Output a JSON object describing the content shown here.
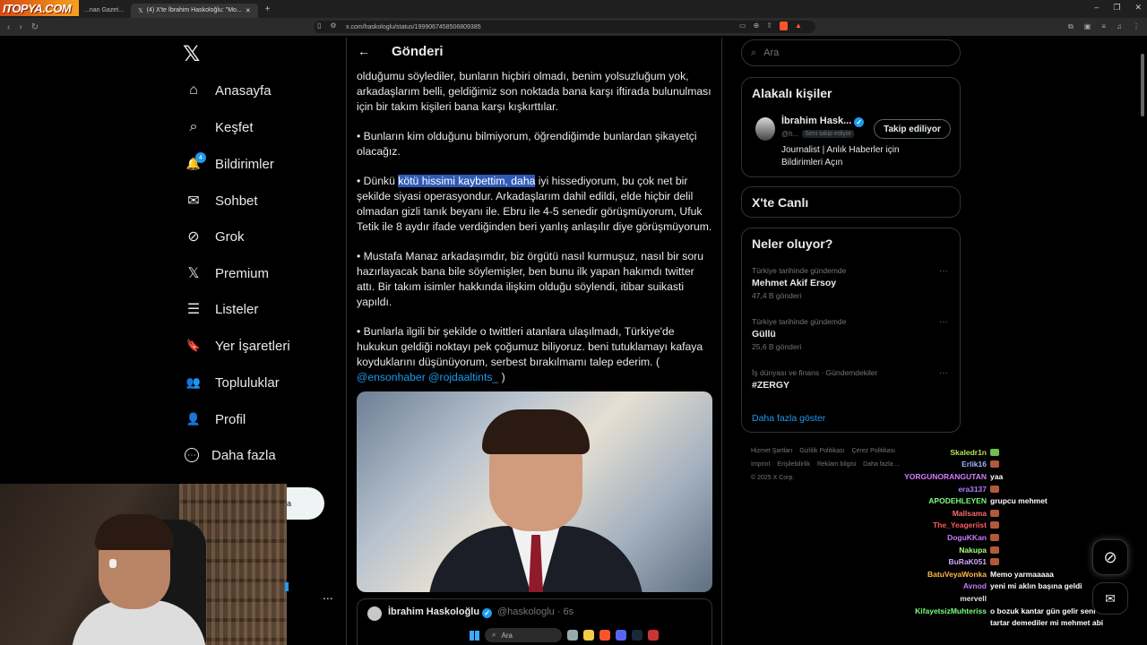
{
  "browser": {
    "logo_text": "ITOPYA.COM",
    "tabs": [
      {
        "label": "...nan Gazet..."
      },
      {
        "label": "(4) X'te İbrahim Haskoloğlu: \"Mo..."
      }
    ],
    "new_tab": "+",
    "window_controls": [
      "–",
      "❐",
      "✕"
    ],
    "url": "x.com/haskologlu/status/1999067458506809385"
  },
  "leftnav": {
    "logo": "𝕏",
    "items": [
      {
        "label": "Anasayfa",
        "icon": "home-icon",
        "glyph": "⌂"
      },
      {
        "label": "Keşfet",
        "icon": "search-icon",
        "glyph": "⌕"
      },
      {
        "label": "Bildirimler",
        "icon": "bell-icon",
        "glyph": "🔔"
      },
      {
        "label": "Sohbet",
        "icon": "envelope-icon",
        "glyph": "✉"
      },
      {
        "label": "Grok",
        "icon": "grok-icon",
        "glyph": "⊘"
      },
      {
        "label": "Premium",
        "icon": "x-premium-icon",
        "glyph": "𝕏"
      },
      {
        "label": "Listeler",
        "icon": "list-icon",
        "glyph": "☰"
      },
      {
        "label": "Yer İşaretleri",
        "icon": "bookmark-icon",
        "glyph": "🔖"
      },
      {
        "label": "Topluluklar",
        "icon": "communities-icon",
        "glyph": "👥"
      },
      {
        "label": "Profil",
        "icon": "profile-icon",
        "glyph": "👤"
      },
      {
        "label": "Daha fazla",
        "icon": "more-icon",
        "glyph": "⋯"
      }
    ],
    "notification_count": "4",
    "post_button_label": "a",
    "more_dots": "..."
  },
  "post": {
    "header_title": "Gönderi",
    "paragraphs": {
      "p1": "olduğumu söylediler, bunların hiçbiri olmadı, benim yolsuzluğum yok, arkadaşlarım belli, geldiğimiz son noktada bana karşı iftirada bulunulması için bir takım kişileri bana karşı kışkırttılar.",
      "p2": "• Bunların kim olduğunu bilmiyorum, öğrendiğimde bunlardan şikayetçi olacağız.",
      "p3_before": "• Dünkü ",
      "p3_highlight": "kötü hissimi kaybettim, daha",
      "p3_after": " iyi hissediyorum, bu çok net bir şekilde siyasi operasyondur. Arkadaşlarım dahil edildi, elde hiçbir delil olmadan gizli tanık beyanı ile. Ebru ile 4-5 senedir görüşmüyorum, Ufuk Tetik ile 8 aydır ifade verdiğinden beri yanlış anlaşılır diye görüşmüyorum.",
      "p4": "• Mustafa Manaz arkadaşımdır, biz örgütü nasıl kurmuşuz, nasıl bir soru hazırlayacak bana bile söylemişler, ben bunu ilk yapan hakımdı twitter attı. Bir takım isimler hakkında ilişkim olduğu söylendi, itibar suikasti yapıldı.",
      "p5_text": "• Bunlarla ilgili bir şekilde o twittleri atanlara ulaşılmadı, Türkiye'de hukukun geldiği noktayı pek çoğumuz biliyoruz. beni tutuklamayı kafaya koyduklarını düşünüyorum, serbest bırakılmamı talep ederim. (",
      "p5_mentions": "@ensonhaber @rojdaaltints_",
      "p5_close": " )"
    },
    "quote": {
      "name": "İbrahim Haskoloğlu",
      "handle": "@haskologlu · 6s"
    }
  },
  "right": {
    "search_placeholder": "Ara",
    "related": {
      "title": "Alakalı kişiler",
      "name": "İbrahim Hask...",
      "handle": "@h...",
      "follows_you": "Seni takip ediyor",
      "follow_button": "Takip ediliyor",
      "bio": "Journalist | Anlık Haberler için Bildirimleri Açın"
    },
    "live": {
      "title": "X'te Canlı"
    },
    "trends": {
      "title": "Neler oluyor?",
      "items": [
        {
          "context": "Türkiye tarihinde gündemde",
          "name": "Mehmet Akif Ersoy",
          "count": "47,4 B gönderi"
        },
        {
          "context": "Türkiye tarihinde gündemde",
          "name": "Güllü",
          "count": "25,6 B gönderi"
        },
        {
          "context": "İş dünyası ve finans · Gündemdekiler",
          "name": "#ZERGY",
          "count": ""
        }
      ],
      "show_more": "Daha fazla göster"
    },
    "footer": {
      "row1": [
        "Hizmet Şartları",
        "Gizlilik Politikası",
        "Çerez Politikası"
      ],
      "row2": [
        "Imprint",
        "Erişilebilirlik",
        "Reklam bilgisi",
        "Daha fazla ..."
      ],
      "row3": "© 2025 X Corp."
    }
  },
  "chat": [
    {
      "user": "Skaledr1n",
      "msg": "",
      "color": "#b6e05a",
      "emote": "green"
    },
    {
      "user": "Erlik16",
      "msg": "",
      "color": "#9fb4ff",
      "emote": "red"
    },
    {
      "user": "YORGUNORANGUTAN",
      "msg": "yaa",
      "color": "#d67cff",
      "emote": ""
    },
    {
      "user": "era3137",
      "msg": "",
      "color": "#b07cff",
      "emote": "red"
    },
    {
      "user": "APODEHLEYEN",
      "msg": "grupcu mehmet",
      "color": "#7cff7c",
      "emote": ""
    },
    {
      "user": "Mallsama",
      "msg": "",
      "color": "#ff6b6b",
      "emote": "red"
    },
    {
      "user": "The_Yeageriist",
      "msg": "",
      "color": "#ff5a5a",
      "emote": "red"
    },
    {
      "user": "DoguKKan",
      "msg": "",
      "color": "#c57cff",
      "emote": "red"
    },
    {
      "user": "Nakupa",
      "msg": "",
      "color": "#a6ff7c",
      "emote": "red"
    },
    {
      "user": "BuRaK051",
      "msg": "",
      "color": "#d2a6ff",
      "emote": "red"
    },
    {
      "user": "BatuVeyaWonka",
      "msg": "Memo yarmaaaaa",
      "color": "#ffb84d",
      "emote": ""
    },
    {
      "user": "Avnod",
      "msg": "yeni mi aklın başına geldi",
      "color": "#c77cff",
      "emote": ""
    },
    {
      "user": "mervell",
      "msg": "",
      "color": "#e0e0e0",
      "emote": ""
    },
    {
      "user": "KifayetsizMuhteriss",
      "msg": "o bozuk kantar gün gelir seni de",
      "color": "#7cff7c",
      "emote": ""
    },
    {
      "user": "",
      "msg": "tartar demediler mi mehmet abi",
      "color": "#ffffff",
      "emote": ""
    }
  ],
  "taskbar": {
    "search_label": "Ara"
  }
}
